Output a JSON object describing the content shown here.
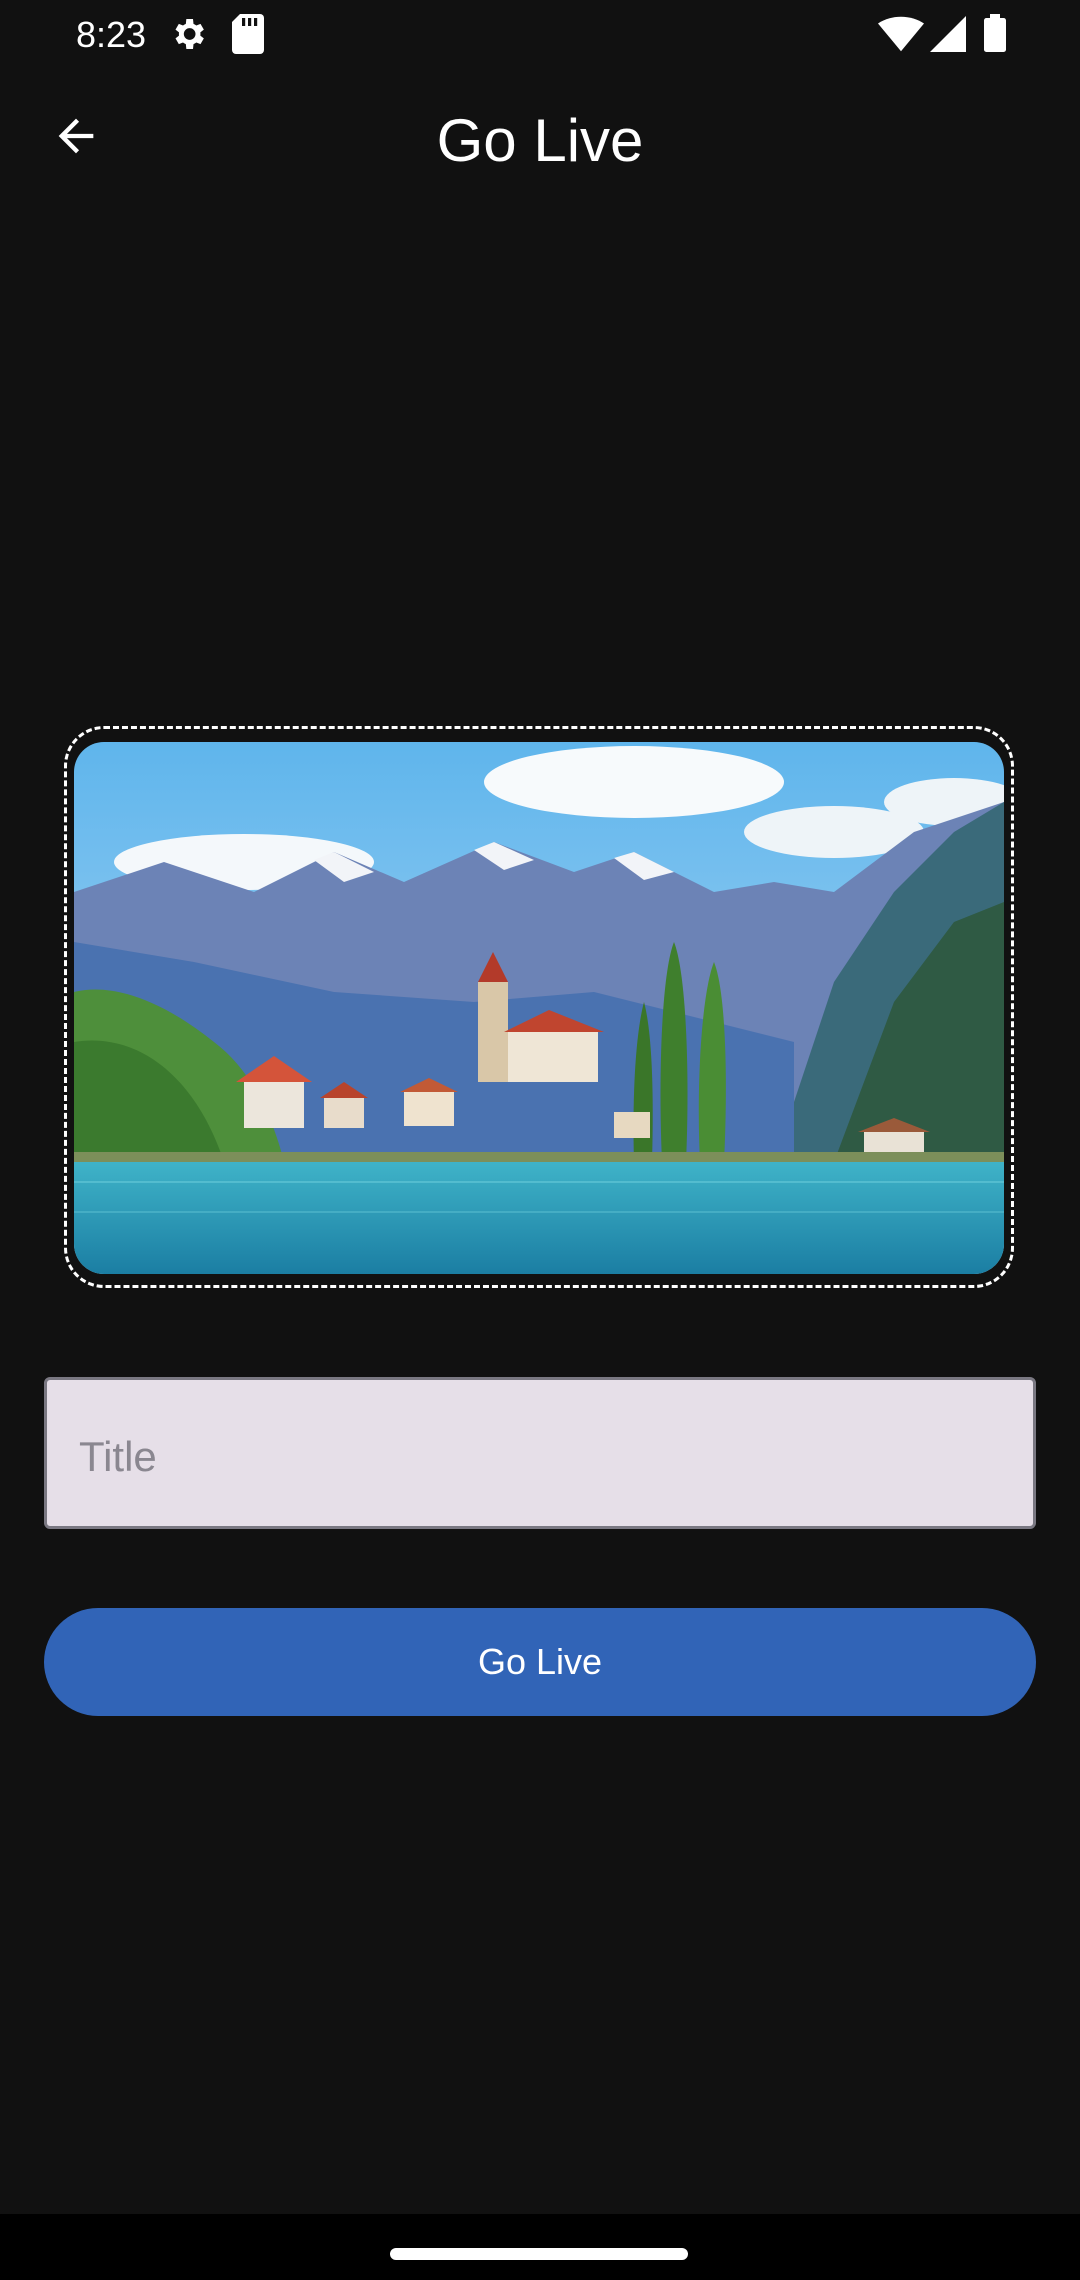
{
  "status_bar": {
    "time": "8:23",
    "icons": [
      "settings-gear-icon",
      "sd-card-icon",
      "wifi-icon",
      "cellular-signal-icon",
      "battery-icon"
    ]
  },
  "app_bar": {
    "back_icon": "arrow-back-icon",
    "title": "Go Live"
  },
  "thumbnail": {
    "description_icon": "landscape-image"
  },
  "title_field": {
    "value": "",
    "placeholder": "Title"
  },
  "go_live_button": {
    "label": "Go Live"
  },
  "colors": {
    "background": "#111111",
    "accent": "#3164b7",
    "field_bg": "#e6dfe8"
  }
}
